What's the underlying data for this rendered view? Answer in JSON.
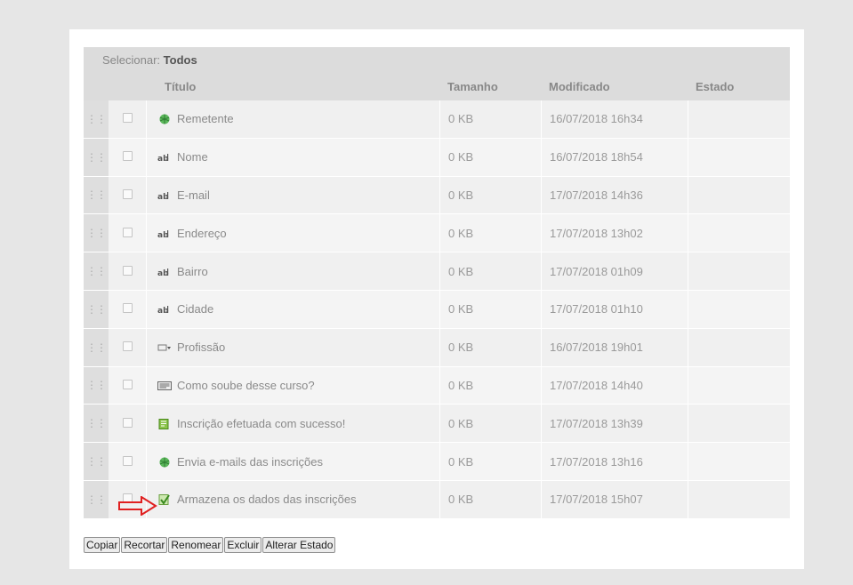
{
  "select": {
    "label": "Selecionar:",
    "all": "Todos"
  },
  "columns": {
    "title": "Título",
    "size": "Tamanho",
    "modified": "Modificado",
    "state": "Estado"
  },
  "rows": [
    {
      "icon": "globe-icon",
      "title": "Remetente",
      "size": "0 KB",
      "modified": "16/07/2018 16h34",
      "state": ""
    },
    {
      "icon": "text-field-icon",
      "title": "Nome",
      "size": "0 KB",
      "modified": "16/07/2018 18h54",
      "state": ""
    },
    {
      "icon": "text-field-icon",
      "title": "E-mail",
      "size": "0 KB",
      "modified": "17/07/2018 14h36",
      "state": ""
    },
    {
      "icon": "text-field-icon",
      "title": "Endereço",
      "size": "0 KB",
      "modified": "17/07/2018 13h02",
      "state": ""
    },
    {
      "icon": "text-field-icon",
      "title": "Bairro",
      "size": "0 KB",
      "modified": "17/07/2018 01h09",
      "state": ""
    },
    {
      "icon": "text-field-icon",
      "title": "Cidade",
      "size": "0 KB",
      "modified": "17/07/2018 01h10",
      "state": ""
    },
    {
      "icon": "select-field-icon",
      "title": "Profissão",
      "size": "0 KB",
      "modified": "16/07/2018 19h01",
      "state": ""
    },
    {
      "icon": "textarea-icon",
      "title": "Como soube desse curso?",
      "size": "0 KB",
      "modified": "17/07/2018 14h40",
      "state": ""
    },
    {
      "icon": "form-page-icon",
      "title": "Inscrição efetuada com sucesso!",
      "size": "0 KB",
      "modified": "17/07/2018 13h39",
      "state": ""
    },
    {
      "icon": "globe-icon",
      "title": "Envia e-mails das inscrições",
      "size": "0 KB",
      "modified": "17/07/2018 13h16",
      "state": ""
    },
    {
      "icon": "save-data-icon",
      "title": "Armazena os dados das inscrições",
      "size": "0 KB",
      "modified": "17/07/2018 15h07",
      "state": ""
    }
  ],
  "buttons": {
    "copy": "Copiar",
    "cut": "Recortar",
    "rename": "Renomear",
    "delete": "Excluir",
    "change_state": "Alterar Estado"
  },
  "colors": {
    "header_bg": "#dcdcdc",
    "row_bg": "#f0f0f0",
    "arrow": "#e02020",
    "icon_green": "#4caf50"
  }
}
